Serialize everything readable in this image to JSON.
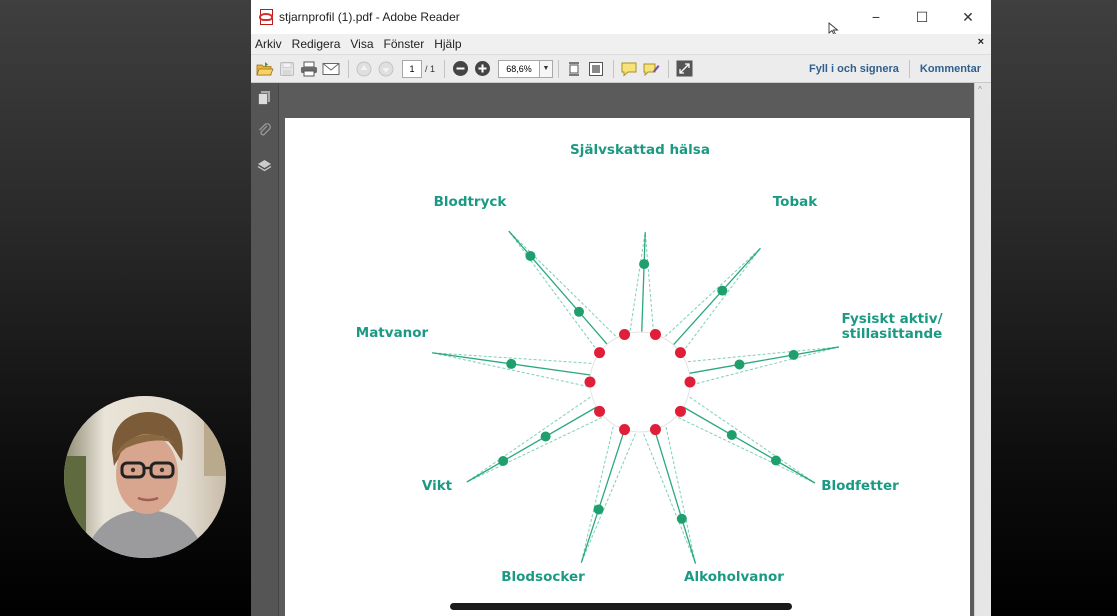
{
  "window": {
    "title": "stjarnprofil (1).pdf - Adobe Reader",
    "controls": {
      "minimize": "−",
      "maximize": "☐",
      "close": "✕"
    }
  },
  "menu": {
    "items": [
      "Arkiv",
      "Redigera",
      "Visa",
      "Fönster",
      "Hjälp"
    ],
    "close": "×"
  },
  "toolbar": {
    "page_current": "1",
    "page_total": "/ 1",
    "zoom": "68,6%",
    "fill_sign": "Fyll i och signera",
    "comment": "Kommentar"
  },
  "icons": {
    "toolbar": [
      "open-icon",
      "save-icon",
      "print-icon",
      "email-icon",
      "previous-page-icon",
      "next-page-icon",
      "zoom-out-icon",
      "zoom-in-icon",
      "fit-width-icon",
      "fit-page-icon",
      "comment-icon",
      "highlight-icon",
      "fullscreen-icon"
    ],
    "sidebar": [
      "pages-icon",
      "attachments-icon",
      "layers-icon"
    ]
  },
  "diagram": {
    "labels": [
      "Självskattad hälsa",
      "Tobak",
      "Fysiskt aktiv/\nstillasittande",
      "Blodfetter",
      "Alkoholvanor",
      "Blodsocker",
      "Vikt",
      "Matvanor",
      "Blodtryck"
    ],
    "colors": {
      "label": "#1b9a83",
      "line": "#2aa882",
      "dashed": "#7fcfb5",
      "outer_dot": "#1f9e6e",
      "inner_dot": "#e01e37"
    }
  }
}
